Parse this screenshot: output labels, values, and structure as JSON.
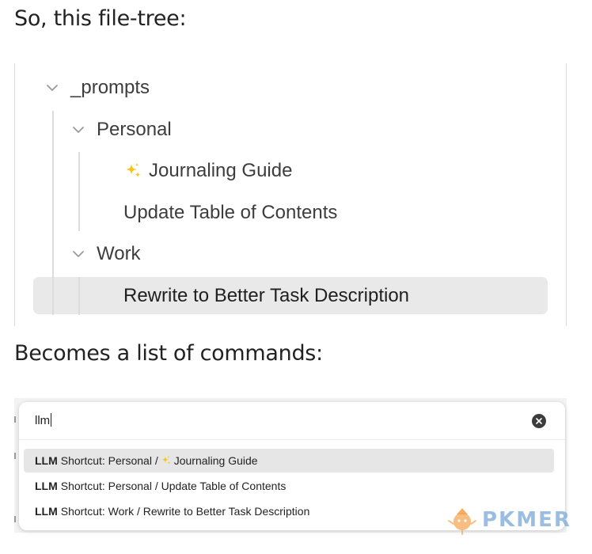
{
  "headings": {
    "intro": "So, this file-tree:",
    "result": "Becomes a list of commands:"
  },
  "file_tree": {
    "root": {
      "label": "_prompts",
      "icon": "chevron-down-icon"
    },
    "folders": [
      {
        "label": "Personal",
        "icon": "chevron-down-icon",
        "files": [
          {
            "label": "Journaling Guide",
            "icon": "sparkles-icon"
          },
          {
            "label": "Update Table of Contents"
          }
        ]
      },
      {
        "label": "Work",
        "icon": "chevron-down-icon",
        "files": [
          {
            "label": "Rewrite to Better Task Description",
            "selected": true
          }
        ]
      }
    ]
  },
  "command_palette": {
    "search_value": "llm",
    "clear_icon": "clear-circle-icon",
    "results": [
      {
        "prefix": "LLM",
        "text_before": "Shortcut: Personal /",
        "icon": "sparkles-icon",
        "text_after": "Journaling Guide",
        "active": true
      },
      {
        "prefix": "LLM",
        "text": "Shortcut: Personal / Update Table of Contents"
      },
      {
        "prefix": "LLM",
        "text": "Shortcut: Work / Rewrite to Better Task Description"
      }
    ]
  },
  "watermark": {
    "text": "PKMER",
    "icon": "pkmer-logo-icon"
  },
  "colors": {
    "selection": "#e9e9e9",
    "active_result": "#e6e6e6",
    "sparkle": "#f5c518",
    "watermark": "#7aa8d8"
  }
}
